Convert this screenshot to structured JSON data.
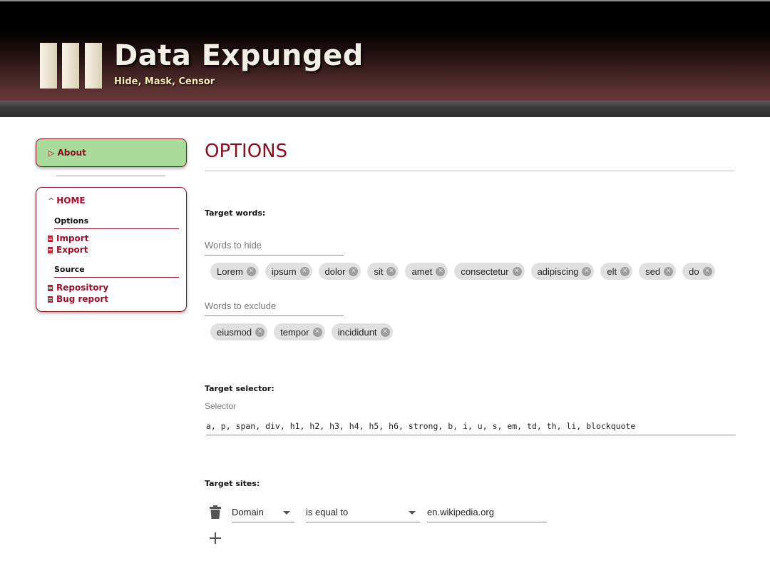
{
  "header": {
    "title": "Data Expunged",
    "subtitle": "Hide, Mask, Censor",
    "logo_icon": "three-bars-logo"
  },
  "sidebar": {
    "about_label": "About",
    "home_label": "HOME",
    "sections": [
      {
        "title": "Options",
        "links": [
          {
            "label": "Import",
            "icon": "document-icon"
          },
          {
            "label": "Export",
            "icon": "document-icon"
          }
        ]
      },
      {
        "title": "Source",
        "links": [
          {
            "label": "Repository",
            "icon": "document-icon"
          },
          {
            "label": "Bug report",
            "icon": "document-icon"
          }
        ]
      }
    ]
  },
  "main": {
    "title": "OPTIONS",
    "target_words": {
      "label": "Target words:",
      "hide_placeholder": "Words to hide",
      "hide_chips": [
        "Lorem",
        "ipsum",
        "dolor",
        "sit",
        "amet",
        "consectetur",
        "adipiscing",
        "elt",
        "sed",
        "do"
      ],
      "exclude_placeholder": "Words to exclude",
      "exclude_chips": [
        "eiusmod",
        "tempor",
        "incididunt"
      ]
    },
    "target_selector": {
      "label": "Target selector:",
      "caption": "Selector",
      "value": "a, p, span, div, h1, h2, h3, h4, h5, h6, strong, b, i, u, s, em, td, th, li, blockquote"
    },
    "target_sites": {
      "label": "Target sites:",
      "field_select": "Domain",
      "operator_select": "is equal to",
      "value": "en.wikipedia.org",
      "delete_icon": "trash-icon",
      "add_icon": "plus-icon"
    }
  },
  "colors": {
    "accent": "#8a1020",
    "about_bg": "#a9dc9a",
    "chip_bg": "#e0e0e0"
  }
}
